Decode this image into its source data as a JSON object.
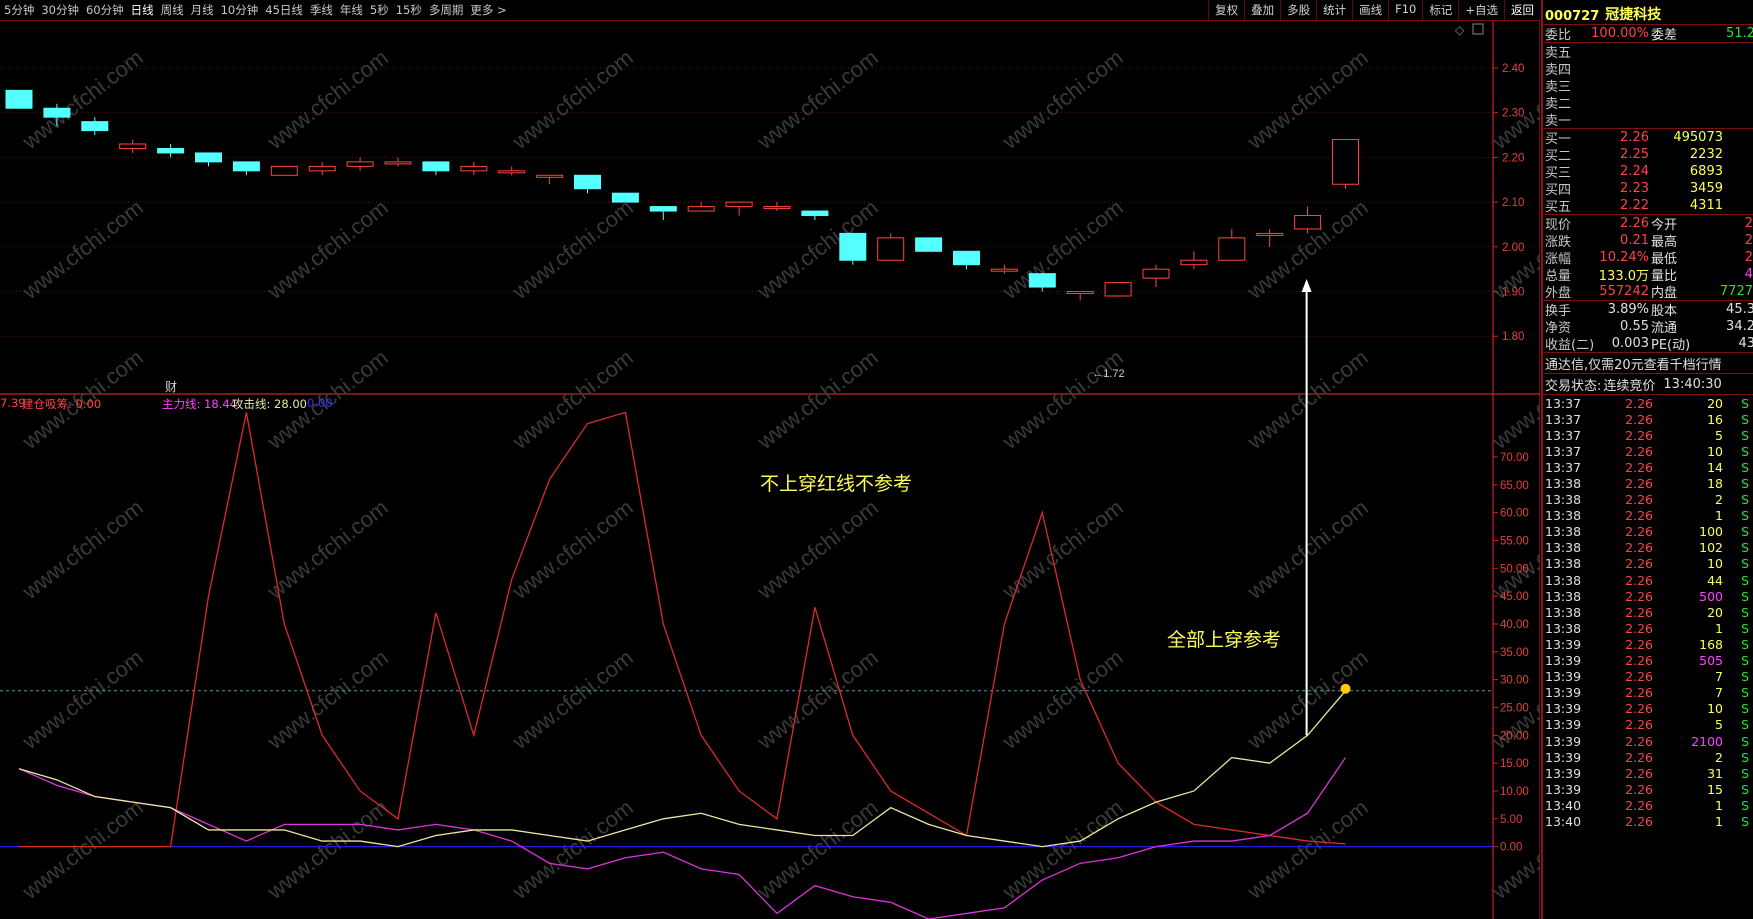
{
  "toolbar": {
    "periods": [
      "5分钟",
      "30分钟",
      "60分钟",
      "日线",
      "周线",
      "月线",
      "10分钟",
      "45日线",
      "季线",
      "年线",
      "5秒",
      "15秒",
      "多周期",
      "更多 >"
    ],
    "active_period": "日线",
    "tools": [
      "复权",
      "叠加",
      "多股",
      "统计",
      "画线",
      "F10",
      "标记",
      "+自选",
      "返回"
    ]
  },
  "chart_data": {
    "type": "candlestick",
    "price_axis": {
      "min": 1.72,
      "max": 2.4,
      "ticks": [
        "2.40",
        "2.30",
        "2.20",
        "2.10",
        "2.00",
        "1.90",
        "1.80"
      ]
    },
    "candles": [
      {
        "o": 2.35,
        "c": 2.31,
        "h": 2.35,
        "l": 2.31
      },
      {
        "o": 2.31,
        "c": 2.29,
        "h": 2.32,
        "l": 2.27
      },
      {
        "o": 2.28,
        "c": 2.26,
        "h": 2.29,
        "l": 2.25
      },
      {
        "o": 2.22,
        "c": 2.23,
        "h": 2.24,
        "l": 2.21
      },
      {
        "o": 2.22,
        "c": 2.21,
        "h": 2.23,
        "l": 2.2
      },
      {
        "o": 2.21,
        "c": 2.19,
        "h": 2.21,
        "l": 2.18
      },
      {
        "o": 2.19,
        "c": 2.17,
        "h": 2.19,
        "l": 2.16
      },
      {
        "o": 2.16,
        "c": 2.18,
        "h": 2.18,
        "l": 2.16
      },
      {
        "o": 2.17,
        "c": 2.18,
        "h": 2.19,
        "l": 2.16
      },
      {
        "o": 2.18,
        "c": 2.19,
        "h": 2.2,
        "l": 2.17
      },
      {
        "o": 2.19,
        "c": 2.19,
        "h": 2.2,
        "l": 2.18
      },
      {
        "o": 2.19,
        "c": 2.17,
        "h": 2.19,
        "l": 2.16
      },
      {
        "o": 2.17,
        "c": 2.18,
        "h": 2.19,
        "l": 2.16
      },
      {
        "o": 2.17,
        "c": 2.17,
        "h": 2.18,
        "l": 2.16
      },
      {
        "o": 2.16,
        "c": 2.16,
        "h": 2.16,
        "l": 2.14
      },
      {
        "o": 2.16,
        "c": 2.13,
        "h": 2.16,
        "l": 2.12
      },
      {
        "o": 2.12,
        "c": 2.1,
        "h": 2.12,
        "l": 2.1
      },
      {
        "o": 2.09,
        "c": 2.08,
        "h": 2.09,
        "l": 2.06
      },
      {
        "o": 2.08,
        "c": 2.09,
        "h": 2.1,
        "l": 2.08
      },
      {
        "o": 2.09,
        "c": 2.1,
        "h": 2.1,
        "l": 2.07
      },
      {
        "o": 2.09,
        "c": 2.09,
        "h": 2.1,
        "l": 2.08
      },
      {
        "o": 2.08,
        "c": 2.07,
        "h": 2.08,
        "l": 2.06
      },
      {
        "o": 2.03,
        "c": 1.97,
        "h": 2.03,
        "l": 1.96
      },
      {
        "o": 1.97,
        "c": 2.02,
        "h": 2.03,
        "l": 1.97
      },
      {
        "o": 2.02,
        "c": 1.99,
        "h": 2.02,
        "l": 1.99
      },
      {
        "o": 1.99,
        "c": 1.96,
        "h": 1.99,
        "l": 1.95
      },
      {
        "o": 1.95,
        "c": 1.95,
        "h": 1.96,
        "l": 1.94
      },
      {
        "o": 1.94,
        "c": 1.91,
        "h": 1.94,
        "l": 1.9
      },
      {
        "o": 1.9,
        "c": 1.9,
        "h": 1.9,
        "l": 1.88
      },
      {
        "o": 1.89,
        "c": 1.92,
        "h": 1.92,
        "l": 1.89
      },
      {
        "o": 1.93,
        "c": 1.95,
        "h": 1.96,
        "l": 1.91
      },
      {
        "o": 1.96,
        "c": 1.97,
        "h": 1.99,
        "l": 1.95
      },
      {
        "o": 1.97,
        "c": 2.02,
        "h": 2.04,
        "l": 1.97
      },
      {
        "o": 2.03,
        "c": 2.03,
        "h": 2.04,
        "l": 2.0
      },
      {
        "o": 2.04,
        "c": 2.07,
        "h": 2.09,
        "l": 2.03
      },
      {
        "o": 2.14,
        "c": 2.24,
        "h": 2.24,
        "l": 2.13
      }
    ],
    "low_label": "1.72",
    "low_index": 28,
    "finance_mark": "财",
    "indicator": {
      "legend": [
        {
          "text": "7.39",
          "color": "#ff4444"
        },
        {
          "text": "建仓吸筹: 0.00",
          "color": "#ff4444"
        },
        {
          "text": "主力线: 18.44",
          "color": "#ff44ff"
        },
        {
          "text": "攻击线: 28.00",
          "color": "#e8e8a0"
        },
        {
          "text": "0.00",
          "color": "#3333ff"
        }
      ],
      "y_ticks": [
        "70.00",
        "65.00",
        "60.00",
        "55.00",
        "50.00",
        "45.00",
        "40.00",
        "35.00",
        "30.00",
        "25.00",
        "20.00",
        "15.00",
        "10.00",
        "5.00",
        "0.00"
      ],
      "ymin": -13,
      "ymax": 77,
      "dashed_level": 28,
      "red_line": [
        0,
        0,
        0,
        0,
        0,
        45,
        78,
        40,
        20,
        10,
        5,
        42,
        20,
        48,
        66,
        76,
        78,
        40,
        20,
        10,
        5,
        43,
        20,
        10,
        6,
        2,
        40,
        60,
        30,
        15,
        8,
        4,
        3,
        2,
        1,
        0.5
      ],
      "yellow_line": [
        14,
        12,
        9,
        8,
        7,
        3,
        3,
        3,
        1,
        1,
        0,
        2,
        3,
        3,
        2,
        1,
        3,
        5,
        6,
        4,
        3,
        2,
        2,
        7,
        4,
        2,
        1,
        0,
        1,
        5,
        8,
        10,
        16,
        15,
        20,
        28
      ],
      "magenta_line": [
        14,
        11,
        9,
        8,
        7,
        4,
        1,
        4,
        4,
        4,
        3,
        4,
        3,
        1,
        -3,
        -4,
        -2,
        -1,
        -4,
        -5,
        -12,
        -7,
        -9,
        -10,
        -13,
        -12,
        -11,
        -6,
        -3,
        -2,
        0,
        1,
        1,
        2,
        6,
        16
      ],
      "annotation_top": "不上穿红线不参考",
      "annotation_bottom": "全部上穿参考"
    }
  },
  "quote": {
    "code": "000727",
    "name": "冠捷科技",
    "weibi_label": "委比",
    "weibi": "100.00%",
    "weicha_label": "委差",
    "weicha": "51.2",
    "sell": [
      {
        "label": "卖五"
      },
      {
        "label": "卖四"
      },
      {
        "label": "卖三"
      },
      {
        "label": "卖二"
      },
      {
        "label": "卖一"
      }
    ],
    "buy": [
      {
        "label": "买一",
        "price": "2.26",
        "vol": "495073"
      },
      {
        "label": "买二",
        "price": "2.25",
        "vol": "2232"
      },
      {
        "label": "买三",
        "price": "2.24",
        "vol": "6893"
      },
      {
        "label": "买四",
        "price": "2.23",
        "vol": "3459"
      },
      {
        "label": "买五",
        "price": "2.22",
        "vol": "4311"
      }
    ],
    "stats": [
      {
        "l1": "现价",
        "v1": "2.26",
        "c1": "red",
        "l2": "今开",
        "v2": "2",
        "c2": "red"
      },
      {
        "l1": "涨跌",
        "v1": "0.21",
        "c1": "red",
        "l2": "最高",
        "v2": "2",
        "c2": "red"
      },
      {
        "l1": "涨幅",
        "v1": "10.24%",
        "c1": "red",
        "l2": "最低",
        "v2": "2",
        "c2": "red"
      },
      {
        "l1": "总量",
        "v1": "133.0万",
        "c1": "yel",
        "l2": "量比",
        "v2": "4",
        "c2": "mag"
      },
      {
        "l1": "外盘",
        "v1": "557242",
        "c1": "red",
        "l2": "内盘",
        "v2": "7727",
        "c2": "grn"
      }
    ],
    "stats2": [
      {
        "l1": "换手",
        "v1": "3.89%",
        "l2": "股本",
        "v2": "45.3"
      },
      {
        "l1": "净资",
        "v1": "0.55",
        "l2": "流通",
        "v2": "34.2"
      },
      {
        "l1": "收益(二)",
        "v1": "0.003",
        "l2": "PE(动)",
        "v2": "43"
      }
    ],
    "promo": "通达信,仅需20元查看千档行情",
    "status_label": "交易状态:",
    "status_value": "连续竞价",
    "status_time": "13:40:30",
    "ticks": [
      {
        "t": "13:37",
        "p": "2.26",
        "v": "20",
        "s": "S",
        "vc": "yel"
      },
      {
        "t": "13:37",
        "p": "2.26",
        "v": "16",
        "s": "S",
        "vc": "yel"
      },
      {
        "t": "13:37",
        "p": "2.26",
        "v": "5",
        "s": "S",
        "vc": "yel"
      },
      {
        "t": "13:37",
        "p": "2.26",
        "v": "10",
        "s": "S",
        "vc": "yel"
      },
      {
        "t": "13:37",
        "p": "2.26",
        "v": "14",
        "s": "S",
        "vc": "yel"
      },
      {
        "t": "13:38",
        "p": "2.26",
        "v": "18",
        "s": "S",
        "vc": "yel"
      },
      {
        "t": "13:38",
        "p": "2.26",
        "v": "2",
        "s": "S",
        "vc": "yel"
      },
      {
        "t": "13:38",
        "p": "2.26",
        "v": "1",
        "s": "S",
        "vc": "yel"
      },
      {
        "t": "13:38",
        "p": "2.26",
        "v": "100",
        "s": "S",
        "vc": "yel"
      },
      {
        "t": "13:38",
        "p": "2.26",
        "v": "102",
        "s": "S",
        "vc": "yel"
      },
      {
        "t": "13:38",
        "p": "2.26",
        "v": "10",
        "s": "S",
        "vc": "yel"
      },
      {
        "t": "13:38",
        "p": "2.26",
        "v": "44",
        "s": "S",
        "vc": "yel"
      },
      {
        "t": "13:38",
        "p": "2.26",
        "v": "500",
        "s": "S",
        "vc": "mag"
      },
      {
        "t": "13:38",
        "p": "2.26",
        "v": "20",
        "s": "S",
        "vc": "yel"
      },
      {
        "t": "13:38",
        "p": "2.26",
        "v": "1",
        "s": "S",
        "vc": "yel"
      },
      {
        "t": "13:39",
        "p": "2.26",
        "v": "168",
        "s": "S",
        "vc": "yel"
      },
      {
        "t": "13:39",
        "p": "2.26",
        "v": "505",
        "s": "S",
        "vc": "mag"
      },
      {
        "t": "13:39",
        "p": "2.26",
        "v": "7",
        "s": "S",
        "vc": "yel"
      },
      {
        "t": "13:39",
        "p": "2.26",
        "v": "7",
        "s": "S",
        "vc": "yel"
      },
      {
        "t": "13:39",
        "p": "2.26",
        "v": "10",
        "s": "S",
        "vc": "yel"
      },
      {
        "t": "13:39",
        "p": "2.26",
        "v": "5",
        "s": "S",
        "vc": "yel"
      },
      {
        "t": "13:39",
        "p": "2.26",
        "v": "2100",
        "s": "S",
        "vc": "mag"
      },
      {
        "t": "13:39",
        "p": "2.26",
        "v": "2",
        "s": "S",
        "vc": "yel"
      },
      {
        "t": "13:39",
        "p": "2.26",
        "v": "31",
        "s": "S",
        "vc": "yel"
      },
      {
        "t": "13:39",
        "p": "2.26",
        "v": "15",
        "s": "S",
        "vc": "yel"
      },
      {
        "t": "13:40",
        "p": "2.26",
        "v": "1",
        "s": "S",
        "vc": "yel"
      },
      {
        "t": "13:40",
        "p": "2.26",
        "v": "1",
        "s": "S",
        "vc": "yel"
      }
    ]
  },
  "watermark": "www.cfchi.com",
  "colors": {
    "up": "#ff4444",
    "down": "#54ffff",
    "grid": "#8b1414",
    "axis": "#cc2222"
  }
}
